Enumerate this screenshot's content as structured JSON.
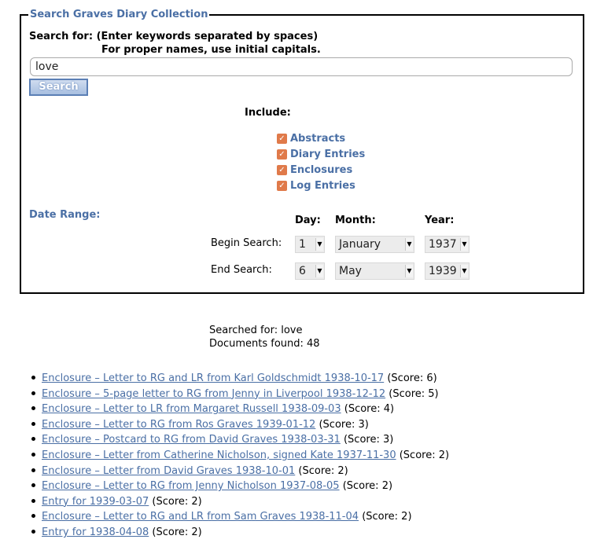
{
  "form": {
    "legend": "Search Graves Diary Collection",
    "search_for_label": "Search for: (Enter keywords separated by spaces)",
    "proper_names_hint": "For proper names, use initial capitals.",
    "search_value": "love",
    "search_button": "Search",
    "include_label": "Include:",
    "checkboxes": [
      {
        "label": "Abstracts",
        "checked": true
      },
      {
        "label": "Diary Entries",
        "checked": true
      },
      {
        "label": "Enclosures",
        "checked": true
      },
      {
        "label": "Log Entries",
        "checked": true
      }
    ],
    "date_range_label": "Date Range:",
    "day_header": "Day:",
    "month_header": "Month:",
    "year_header": "Year:",
    "begin_label": "Begin Search:",
    "end_label": "End Search:",
    "begin": {
      "day": "1",
      "month": "January",
      "year": "1937"
    },
    "end": {
      "day": "6",
      "month": "May",
      "year": "1939"
    }
  },
  "summary": {
    "searched_for": "Searched for: love",
    "documents_found": "Documents found: 48"
  },
  "results": [
    {
      "title": "Enclosure – Letter to RG and LR from Karl Goldschmidt 1938-10-17",
      "score": "(Score: 6)"
    },
    {
      "title": "Enclosure – 5-page letter to RG from Jenny in Liverpool 1938-12-12",
      "score": "(Score: 5)"
    },
    {
      "title": "Enclosure – Letter to LR from Margaret Russell 1938-09-03",
      "score": "(Score: 4)"
    },
    {
      "title": "Enclosure – Letter to RG from Ros Graves 1939-01-12",
      "score": "(Score: 3)"
    },
    {
      "title": "Enclosure – Postcard to RG from David Graves 1938-03-31",
      "score": "(Score: 3)"
    },
    {
      "title": "Enclosure – Letter from Catherine Nicholson, signed Kate 1937-11-30",
      "score": "(Score: 2)"
    },
    {
      "title": "Enclosure – Letter from David Graves 1938-10-01",
      "score": "(Score: 2)"
    },
    {
      "title": "Enclosure – Letter to RG from Jenny Nicholson 1937-08-05",
      "score": "(Score: 2)"
    },
    {
      "title": "Entry for 1939-03-07",
      "score": "(Score: 2)"
    },
    {
      "title": "Enclosure – Letter to RG and LR from Sam Graves 1938-11-04",
      "score": "(Score: 2)"
    },
    {
      "title": "Entry for 1938-04-08",
      "score": "(Score: 2)"
    }
  ]
}
